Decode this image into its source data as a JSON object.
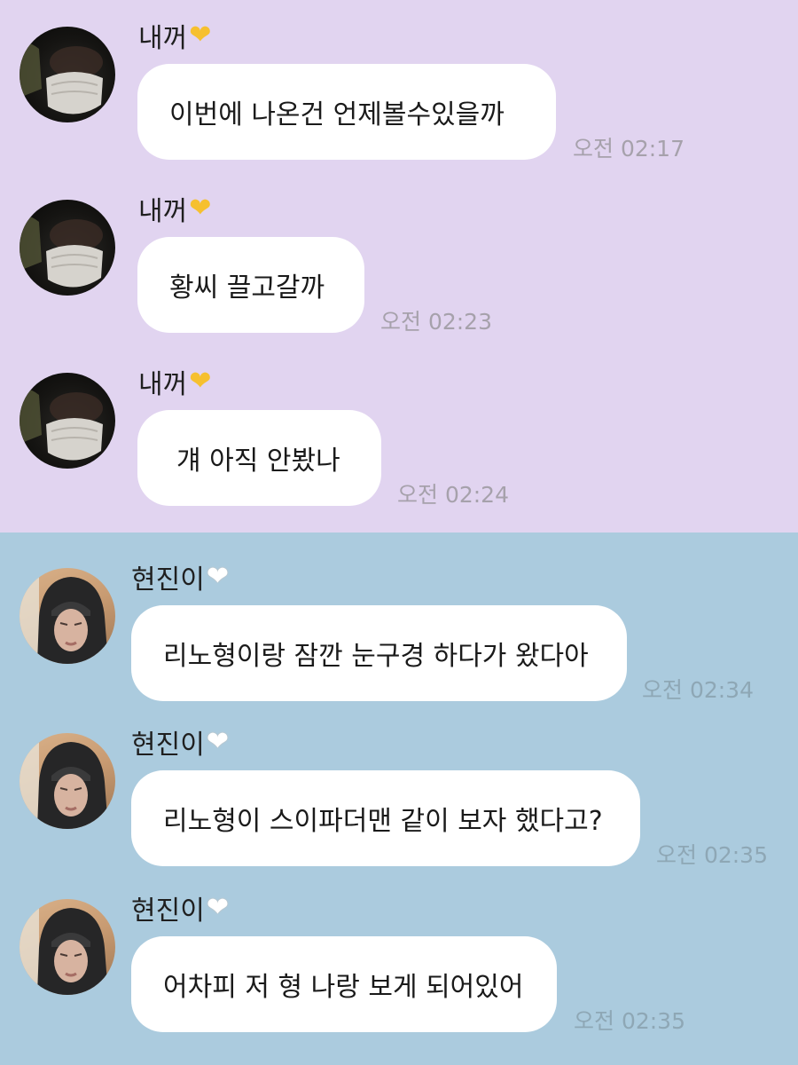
{
  "colors": {
    "top_section_bg": "#e1d4f0",
    "bottom_section_bg": "#abcbde",
    "bubble_bg": "#ffffff",
    "heart_yellow": "#f6c02f",
    "heart_white": "#ffffff"
  },
  "chat_top": {
    "messages": [
      {
        "sender": "내꺼",
        "heart_icon": "yellow-heart-icon",
        "text": "이번에 나온건 언제볼수있을까",
        "time": "오전 02:17"
      },
      {
        "sender": "내꺼",
        "heart_icon": "yellow-heart-icon",
        "text": "황씨 끌고갈까",
        "time": "오전 02:23"
      },
      {
        "sender": "내꺼",
        "heart_icon": "yellow-heart-icon",
        "text": "걔 아직 안봤나",
        "time": "오전 02:24"
      }
    ]
  },
  "chat_bottom": {
    "messages": [
      {
        "sender": "현진이",
        "heart_icon": "white-heart-icon",
        "text": "리노형이랑 잠깐 눈구경 하다가 왔다아",
        "time": "오전 02:34"
      },
      {
        "sender": "현진이",
        "heart_icon": "white-heart-icon",
        "text": "리노형이 스이파더맨 같이 보자 했다고?",
        "time": "오전 02:35"
      },
      {
        "sender": "현진이",
        "heart_icon": "white-heart-icon",
        "text": "어차피 저 형 나랑 보게 되어있어",
        "time": "오전 02:35"
      }
    ]
  }
}
